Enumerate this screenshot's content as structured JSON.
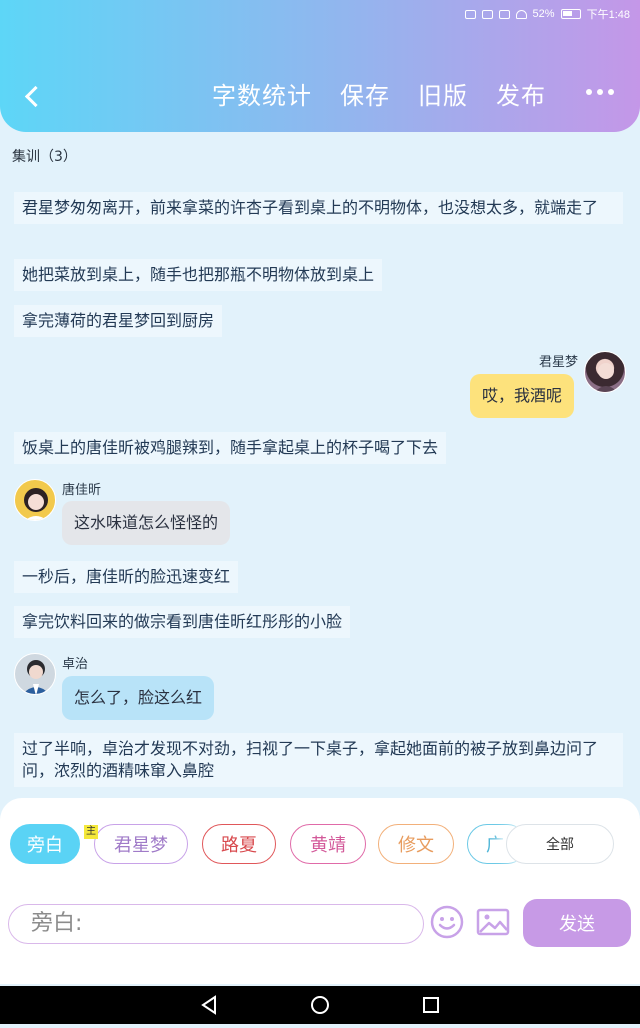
{
  "status_bar": {
    "battery": "52%",
    "time": "下午1:48"
  },
  "nav": {
    "back_icon": "back-chevron-icon",
    "actions": [
      "字数统计",
      "保存",
      "旧版",
      "发布"
    ],
    "more_icon": "more-dots-icon"
  },
  "chapter": {
    "title": "集训（3）"
  },
  "messages": [
    {
      "type": "narration",
      "text": "君星梦匆匆离开，前来拿菜的许杏子看到桌上的不明物体，也没想太多，就端走了"
    },
    {
      "type": "narration",
      "text": "她把菜放到桌上，随手也把那瓶不明物体放到桌上"
    },
    {
      "type": "narration",
      "text": "拿完薄荷的君星梦回到厨房"
    },
    {
      "type": "dialogue",
      "side": "right",
      "speaker": "君星梦",
      "text": "哎，我酒呢",
      "bubble_color": "#fde27c"
    },
    {
      "type": "narration",
      "text": "饭桌上的唐佳昕被鸡腿辣到，随手拿起桌上的杯子喝了下去"
    },
    {
      "type": "dialogue",
      "side": "left",
      "speaker": "唐佳昕",
      "text": "这水味道怎么怪怪的",
      "bubble_color": "#e4e6ea"
    },
    {
      "type": "narration",
      "text": "一秒后，唐佳昕的脸迅速变红"
    },
    {
      "type": "narration",
      "text": "拿完饮料回来的做宗看到唐佳昕红彤彤的小脸"
    },
    {
      "type": "dialogue",
      "side": "left",
      "speaker": "卓治",
      "text": "怎么了，脸这么红",
      "bubble_color": "#b8e3f8"
    },
    {
      "type": "narration",
      "text": "过了半响，卓治才发现不对劲，扫视了一下桌子，拿起她面前的被子放到鼻边问了问，浓烈的酒精味窜入鼻腔"
    }
  ],
  "roles": {
    "items": [
      {
        "label": "旁白",
        "active": true,
        "color": "#5ad3f5"
      },
      {
        "label": "君星梦",
        "active": false,
        "color": "#c8a2e8"
      },
      {
        "label": "路夏",
        "active": false,
        "color": "#e0575a"
      },
      {
        "label": "黄靖",
        "active": false,
        "color": "#e06aa8"
      },
      {
        "label": "修文",
        "active": false,
        "color": "#f2b07a"
      },
      {
        "label": "广",
        "active": false,
        "color": "#6cc9e6"
      }
    ],
    "main_tag": "主",
    "all_label": "全部"
  },
  "composer": {
    "placeholder": "旁白:",
    "emoji_icon": "smiley-icon",
    "image_icon": "image-icon",
    "send_label": "发送"
  },
  "system_nav": {
    "back_icon": "triangle-back-icon",
    "home_icon": "circle-home-icon",
    "recents_icon": "square-recents-icon"
  }
}
